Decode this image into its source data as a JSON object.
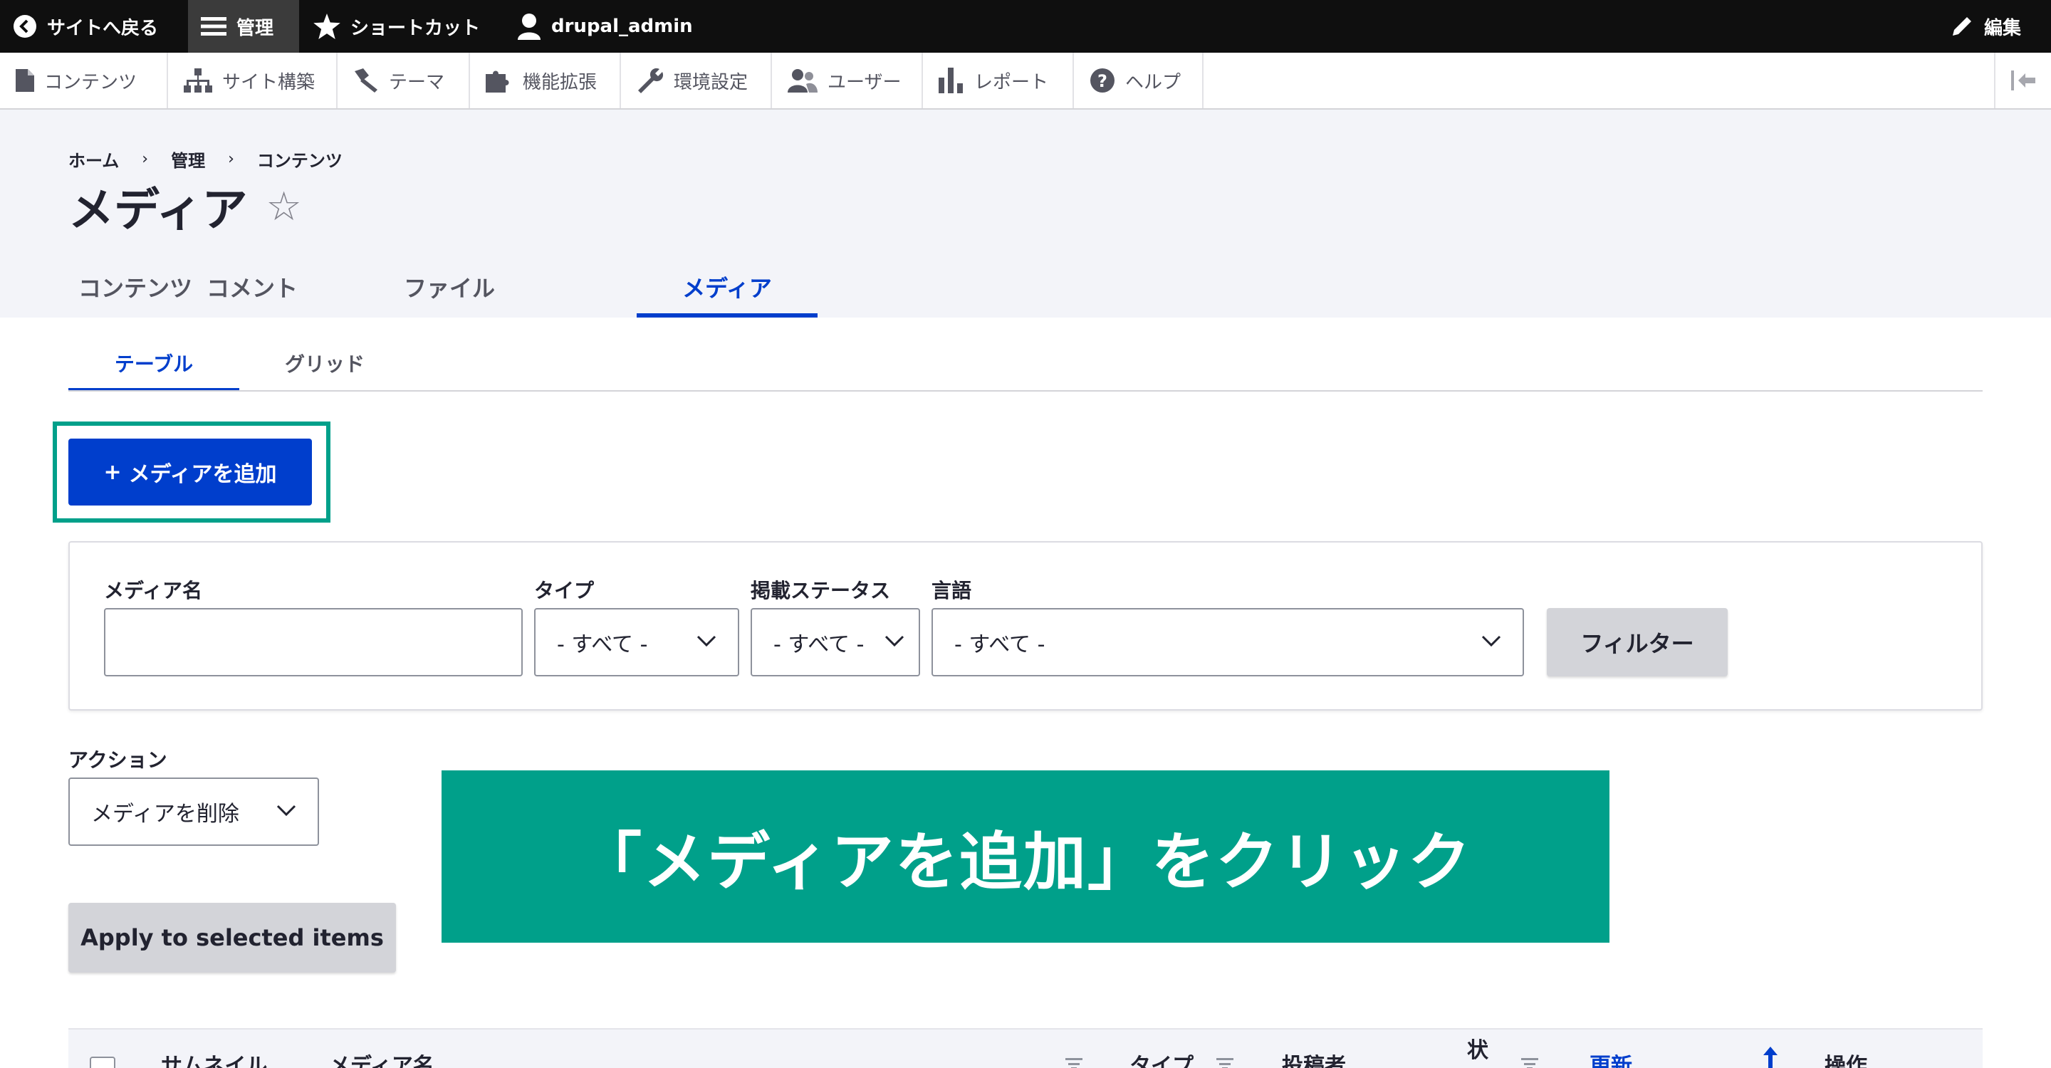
{
  "toolbar": {
    "back_label": "サイトへ戻る",
    "manage_label": "管理",
    "shortcut_label": "ショートカット",
    "user_label": "drupal_admin",
    "edit_label": "編集"
  },
  "tray": {
    "items": [
      {
        "label": "コンテンツ",
        "icon": "file-icon"
      },
      {
        "label": "サイト構築",
        "icon": "sitemap-icon"
      },
      {
        "label": "テーマ",
        "icon": "paintbrush-icon"
      },
      {
        "label": "機能拡張",
        "icon": "puzzle-icon"
      },
      {
        "label": "環境設定",
        "icon": "wrench-icon"
      },
      {
        "label": "ユーザー",
        "icon": "people-icon"
      },
      {
        "label": "レポート",
        "icon": "bar-chart-icon"
      },
      {
        "label": "ヘルプ",
        "icon": "help-icon"
      }
    ]
  },
  "breadcrumb": {
    "items": [
      "ホーム",
      "管理",
      "コンテンツ"
    ],
    "separator": "›"
  },
  "page": {
    "title": "メディア",
    "star": "☆"
  },
  "primary_tabs": [
    {
      "label": "コンテンツ",
      "active": false
    },
    {
      "label": "コメント",
      "active": false
    },
    {
      "label": "ファイル",
      "active": false
    },
    {
      "label": "メディア",
      "active": true
    }
  ],
  "secondary_tabs": [
    {
      "label": "テーブル",
      "active": true
    },
    {
      "label": "グリッド",
      "active": false
    }
  ],
  "add_button": {
    "plus": "+",
    "label": "メディアを追加"
  },
  "filters": {
    "name_label": "メディア名",
    "name_value": "",
    "type_label": "タイプ",
    "type_value": "- すべて -",
    "status_label": "掲載ステータス",
    "status_value": "- すべて -",
    "language_label": "言語",
    "language_value": "- すべて -",
    "filter_button": "フィルター"
  },
  "actions": {
    "label": "アクション",
    "selected": "メディアを削除",
    "apply_button": "Apply to selected items"
  },
  "banner": {
    "text": "「メディアを追加」をクリック"
  },
  "table": {
    "columns": [
      "サムネイル",
      "メディア名",
      "タイプ",
      "投稿者",
      "状",
      "更新",
      "操作"
    ]
  },
  "colors": {
    "accent": "#003ecc",
    "highlight": "#00a08a",
    "toolbar_bg": "#0f0f0f"
  }
}
